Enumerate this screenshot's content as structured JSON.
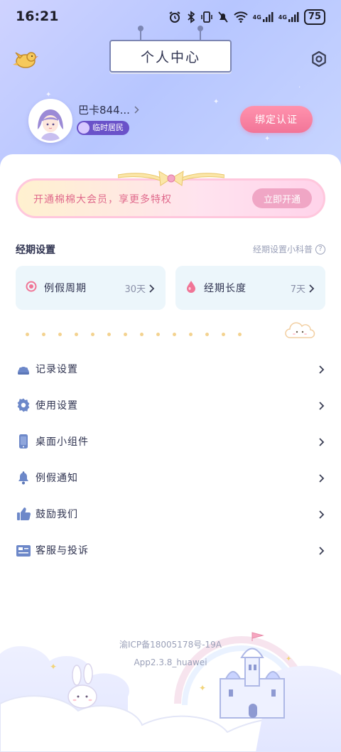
{
  "status_bar": {
    "time": "16:21",
    "signal1": "4G",
    "signal2": "4G",
    "battery": "75"
  },
  "header": {
    "title": "个人中心",
    "left_icon": "bird-icon",
    "right_icon": "settings-icon"
  },
  "profile": {
    "name": "巴卡844...",
    "badge": "临时居民",
    "bind_label": "绑定认证"
  },
  "vip": {
    "text": "开通棉棉大会员，享更多特权",
    "button": "立即开通"
  },
  "period": {
    "section_title": "经期设置",
    "help_label": "经期设置小科普",
    "cycle_label": "例假周期",
    "cycle_value": "30天",
    "length_label": "经期长度",
    "length_value": "7天"
  },
  "menu": [
    {
      "label": "记录设置",
      "icon": "record-icon"
    },
    {
      "label": "使用设置",
      "icon": "gear-icon"
    },
    {
      "label": "桌面小组件",
      "icon": "phone-icon"
    },
    {
      "label": "例假通知",
      "icon": "bell-icon"
    },
    {
      "label": "鼓励我们",
      "icon": "thumbs-up-icon"
    },
    {
      "label": "客服与投诉",
      "icon": "inbox-icon"
    }
  ],
  "footer": {
    "icp": "渝ICP备18005178号-19A",
    "version": "App2.3.8_huawei"
  },
  "colors": {
    "accent_pink": "#f27598",
    "header_bg": "#b7c6ff",
    "card_bg": "#ecf6fb"
  }
}
